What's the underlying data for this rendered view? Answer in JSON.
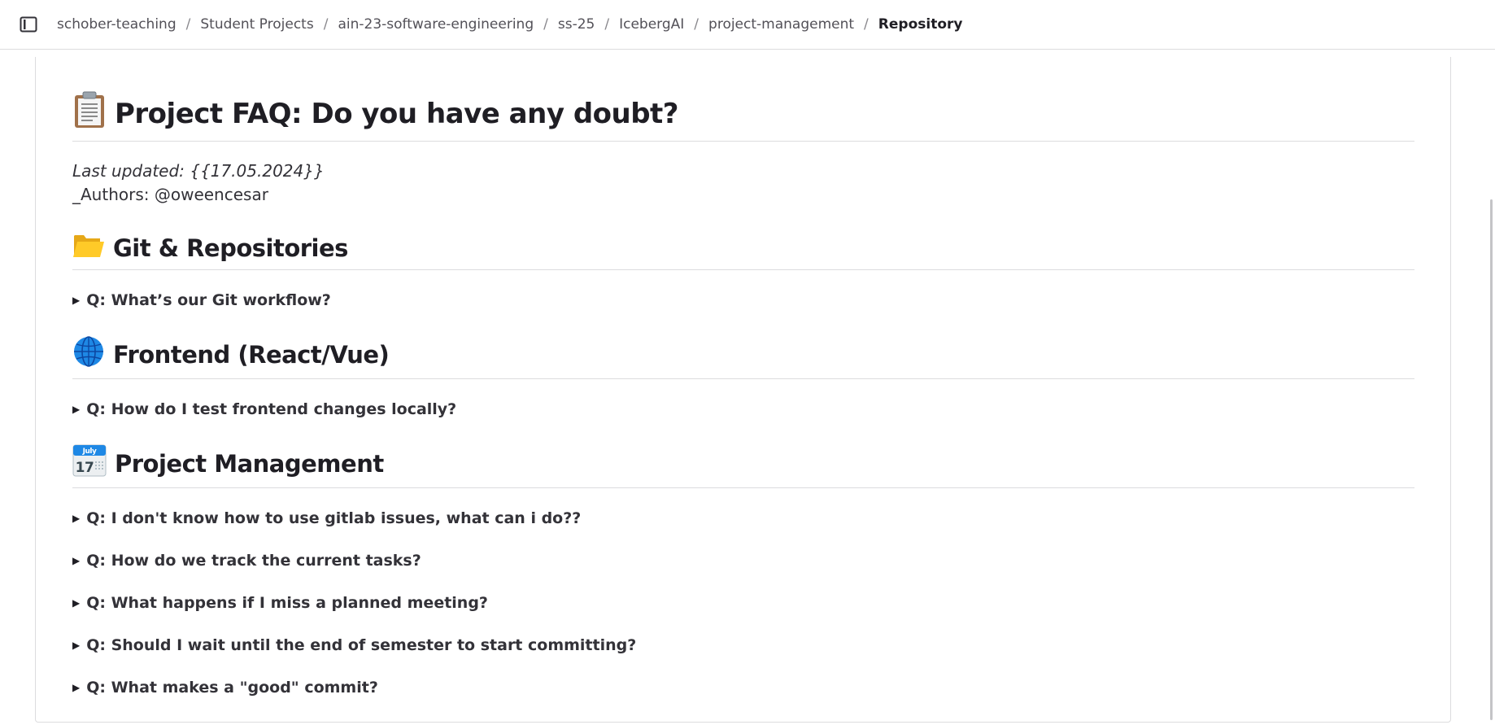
{
  "breadcrumb": [
    "schober-teaching",
    "Student Projects",
    "ain-23-software-engineering",
    "ss-25",
    "IcebergAI",
    "project-management"
  ],
  "breadcrumb_current": "Repository",
  "doc": {
    "title": "Project FAQ: Do you have any doubt?",
    "title_icon": "clipboard-icon",
    "last_updated": "Last updated: {{17.05.2024}}",
    "authors": "_Authors: @oweencesar",
    "sections": [
      {
        "title": "Git & Repositories",
        "icon": "folder-icon",
        "questions": [
          "Q: What’s our Git workflow?"
        ]
      },
      {
        "title": "Frontend (React/Vue)",
        "icon": "globe-icon",
        "questions": [
          "Q: How do I test frontend changes locally?"
        ]
      },
      {
        "title": "Project Management",
        "icon": "calendar-icon",
        "calendar": {
          "month": "July",
          "day": "17"
        },
        "questions": [
          "Q: I don't know how to use gitlab issues, what can i do??",
          "Q: How do we track the current tasks?",
          "Q: What happens if I miss a planned meeting?",
          "Q: Should I wait until the end of semester to start committing?",
          "Q: What makes a \"good\" commit?"
        ]
      }
    ]
  }
}
